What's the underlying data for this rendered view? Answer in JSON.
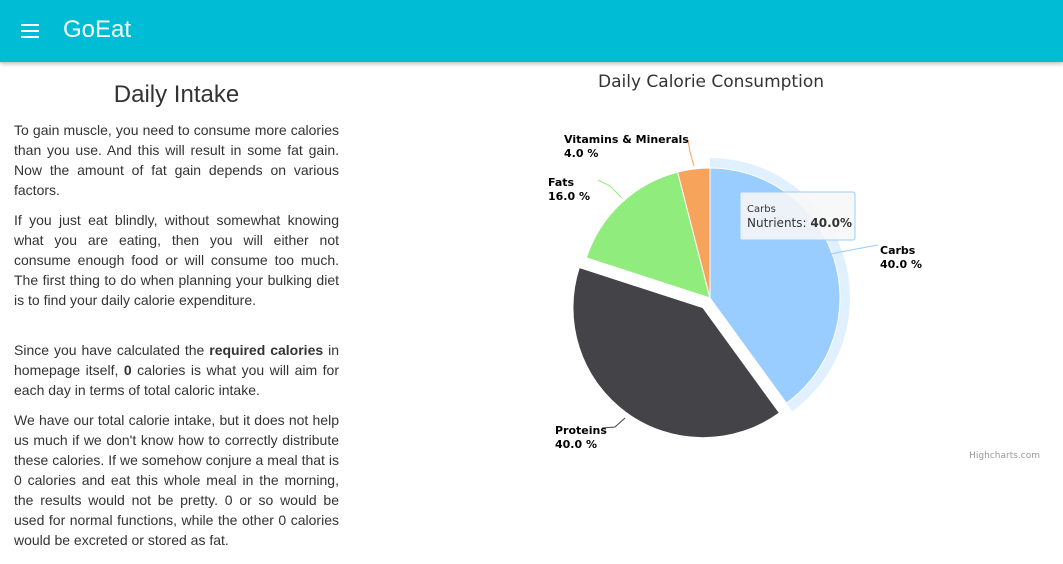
{
  "appbar": {
    "title": "GoEat",
    "menu_icon": "hamburger-menu-icon",
    "color": "#00bcd4"
  },
  "content": {
    "heading": "Daily Intake",
    "p1": "To gain muscle, you need to consume more calories than you use. And this will result in some fat gain. Now the amount of fat gain depends on various factors.",
    "p2": "If you just eat blindly, without somewhat knowing what you are eating, then you will either not consume enough food or will consume too much. The first thing to do when planning your bulking diet is to find your daily calorie expenditure.",
    "p3": {
      "a": "Since you have calculated the ",
      "b": "required calories",
      "c": " in homepage itself, ",
      "d": "0",
      "e": " calories is what you will aim for each day in terms of total caloric intake."
    },
    "p4": "We have our total calorie intake, but it does not help us much if we don't know how to correctly distribute these calories. If we somehow conjure a meal that is 0 calories and eat this whole meal in the morning, the results would not be pretty. 0 or so would be used for normal functions, while the other 0 calories would be excreted or stored as fat."
  },
  "chart_data": {
    "type": "pie",
    "title": "Daily Calorie Consumption",
    "series_name": "Nutrients",
    "slices": [
      {
        "name": "Carbs",
        "value": 40.0,
        "label": "40.0 %",
        "color": "#99ccff",
        "hovered": true
      },
      {
        "name": "Proteins",
        "value": 40.0,
        "label": "40.0 %",
        "color": "#434348",
        "sliced": true
      },
      {
        "name": "Fats",
        "value": 16.0,
        "label": "16.0 %",
        "color": "#90ed7d"
      },
      {
        "name": "Vitamins & Minerals",
        "value": 4.0,
        "label": "4.0 %",
        "color": "#f7a35c"
      }
    ],
    "tooltip": {
      "title": "Carbs",
      "label": "Nutrients:",
      "value": "40.0%"
    },
    "credits": "Highcharts.com"
  }
}
